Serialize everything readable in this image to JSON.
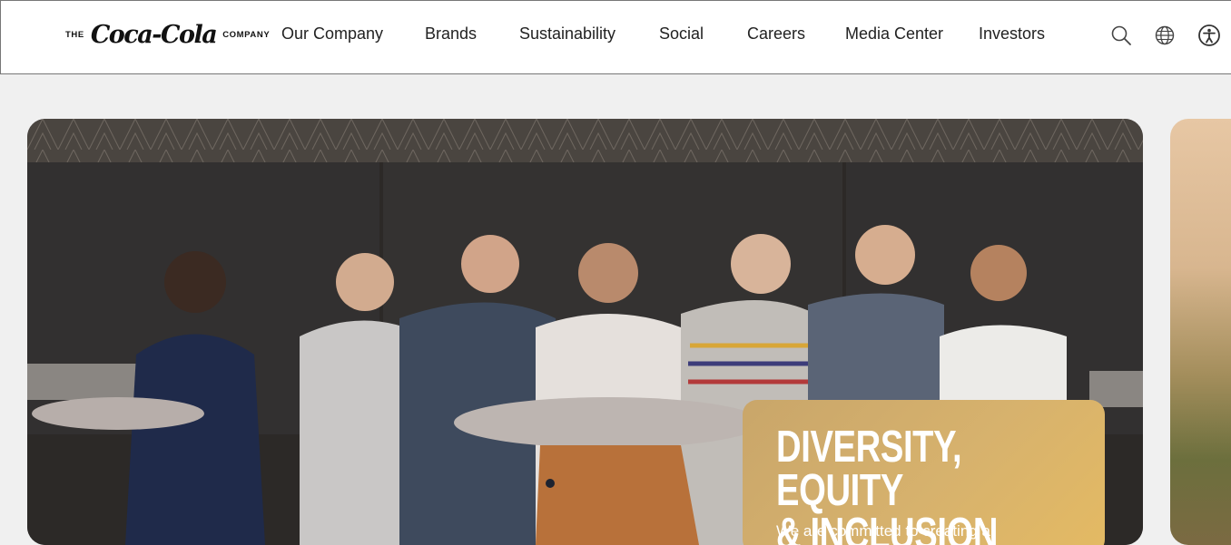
{
  "logo": {
    "prefix": "THE",
    "script": "Coca-Cola",
    "suffix": "COMPANY"
  },
  "nav": {
    "items": [
      {
        "label": "Our Company"
      },
      {
        "label": "Brands"
      },
      {
        "label": "Sustainability"
      },
      {
        "label": "Social"
      },
      {
        "label": "Careers"
      },
      {
        "label": "Media Center"
      },
      {
        "label": "Investors"
      }
    ]
  },
  "header_icons": [
    "search-icon",
    "globe-icon",
    "accessibility-icon"
  ],
  "hero": {
    "card_title": "DIVERSITY, EQUITY\n& INCLUSION",
    "card_text": "We are committed to creating a",
    "card_color": "#d7b26d"
  }
}
